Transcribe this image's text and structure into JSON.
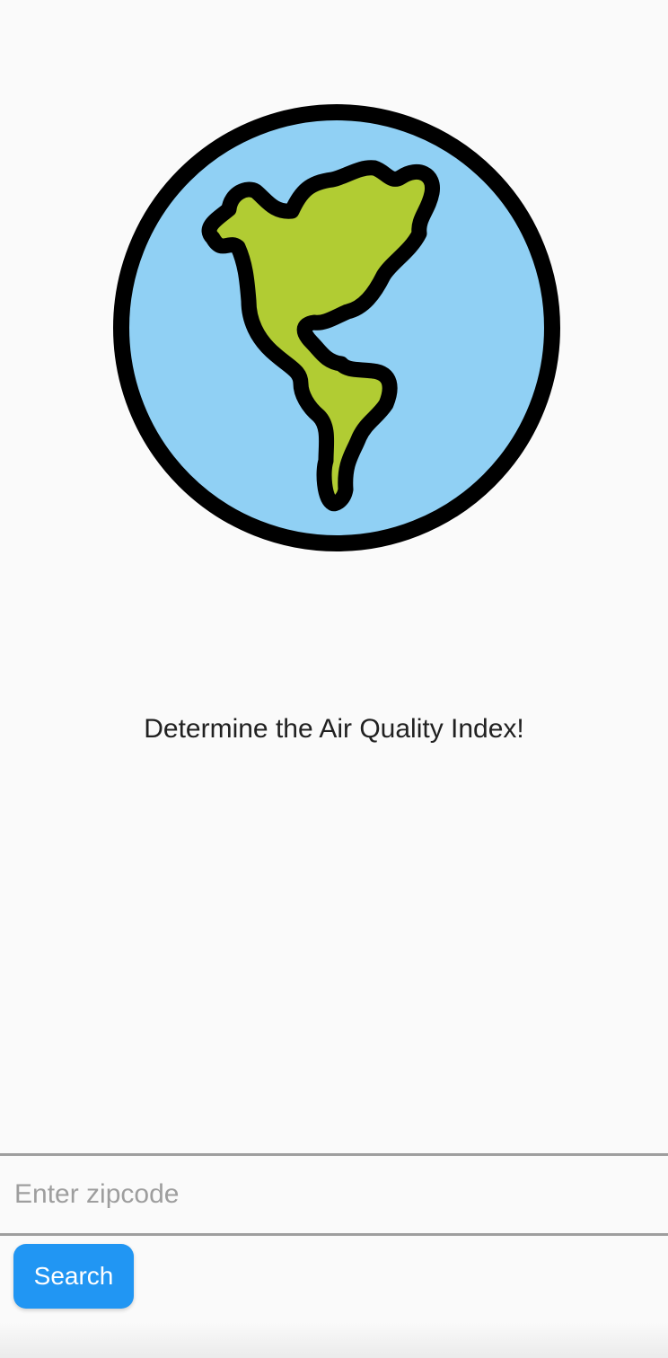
{
  "hero": {
    "icon": "globe-americas-icon",
    "colors": {
      "ocean": "#90d0f4",
      "land": "#b1cc33",
      "outline": "#000000"
    }
  },
  "tagline": "Determine the Air Quality Index!",
  "zip_input": {
    "placeholder": "Enter zipcode",
    "value": ""
  },
  "search_button": {
    "label": "Search",
    "color": "#2196f3"
  }
}
